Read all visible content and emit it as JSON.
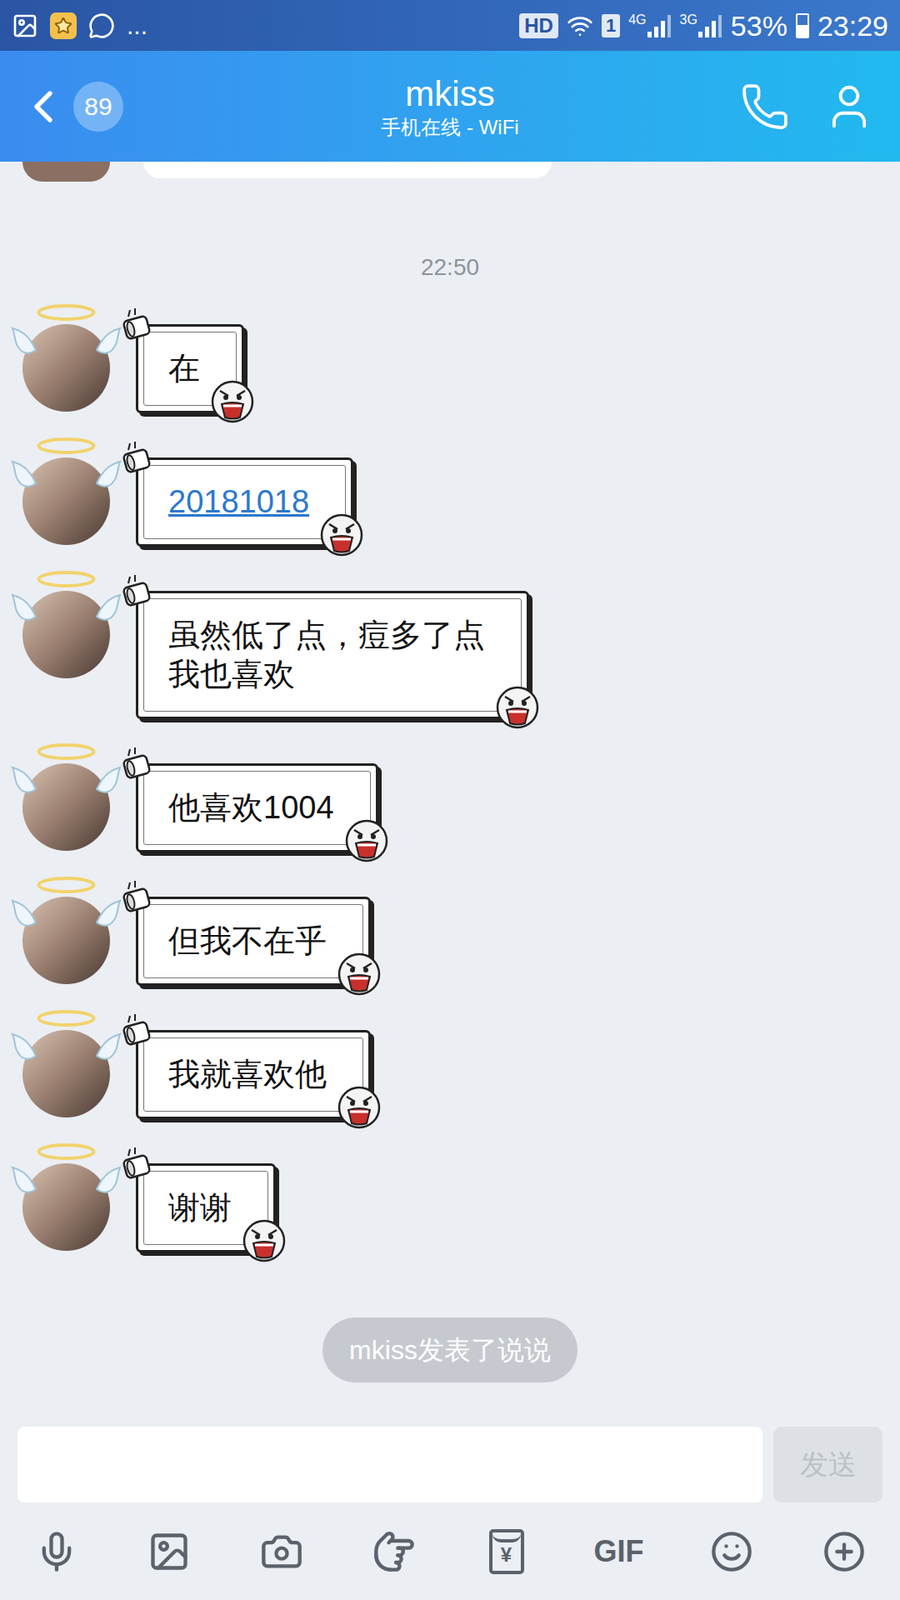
{
  "status_bar": {
    "more": "...",
    "hd": "HD",
    "sim_slot": "1",
    "network_1": "4G",
    "network_2": "3G",
    "battery": "53%",
    "battery_level": 0.53,
    "time": "23:29"
  },
  "header": {
    "back_badge": "89",
    "title": "mkiss",
    "subtitle": "手机在线 - WiFi"
  },
  "chat": {
    "timestamp": "22:50",
    "messages": [
      {
        "kind": "text",
        "lines": [
          "在"
        ]
      },
      {
        "kind": "link",
        "lines": [
          "20181018"
        ]
      },
      {
        "kind": "text",
        "lines": [
          "虽然低了点，痘多了点",
          "我也喜欢"
        ]
      },
      {
        "kind": "text",
        "lines": [
          "他喜欢1004"
        ]
      },
      {
        "kind": "text",
        "lines": [
          "但我不在乎"
        ]
      },
      {
        "kind": "text",
        "lines": [
          "我就喜欢他"
        ]
      },
      {
        "kind": "text",
        "lines": [
          "谢谢"
        ]
      }
    ],
    "notice": "mkiss发表了说说"
  },
  "input": {
    "value": "",
    "send_label": "发送",
    "send_disabled": true
  },
  "toolbar": [
    {
      "kind": "mic"
    },
    {
      "kind": "image"
    },
    {
      "kind": "camera"
    },
    {
      "kind": "poke"
    },
    {
      "kind": "redpacket",
      "label": "¥"
    },
    {
      "kind": "gif",
      "label": "GIF"
    },
    {
      "kind": "emoji"
    },
    {
      "kind": "plus"
    }
  ]
}
